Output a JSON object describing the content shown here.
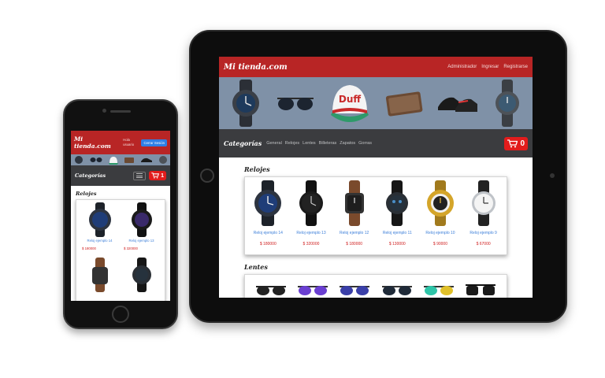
{
  "tablet": {
    "logo": "Mi tienda.com",
    "nav_links": [
      "Administrador",
      "Ingresar",
      "Registrarse"
    ],
    "banner_items": [
      "watch-icon",
      "sunglasses-icon",
      "cap-icon",
      "wallet-icon",
      "shoes-icon",
      "watch-icon"
    ],
    "cap_text": "Duff",
    "categories_label": "Categorías",
    "categories": [
      "General",
      "Relojes",
      "Lentes",
      "Billeteras",
      "Zapatos",
      "Gorras"
    ],
    "cart_count": "0",
    "sections": [
      {
        "title": "Relojes",
        "products": [
          {
            "name": "Reloj ejemplo 14",
            "price": "$ 180000"
          },
          {
            "name": "Reloj ejemplo 13",
            "price": "$ 320000"
          },
          {
            "name": "Reloj ejemplo 12",
            "price": "$ 180000"
          },
          {
            "name": "Reloj ejemplo 11",
            "price": "$ 130000"
          },
          {
            "name": "Reloj ejemplo 10",
            "price": "$ 90000"
          },
          {
            "name": "Reloj ejemplo 9",
            "price": "$ 67000"
          }
        ]
      },
      {
        "title": "Lentes"
      }
    ]
  },
  "phone": {
    "logo": "Mi tienda.com",
    "greeting": "Hola usuario",
    "logout_label": "Cerrar Sesión",
    "categories_label": "Categorías",
    "cart_count": "1",
    "section_title": "Relojes",
    "products": [
      {
        "name": "Reloj ejemplo 14",
        "price": "$ 180000"
      },
      {
        "name": "Reloj ejemplo 13",
        "price": "$ 320000"
      }
    ]
  },
  "colors": {
    "brand_red": "#b82525",
    "banner_blue": "#7f91a7",
    "category_bar": "#3b3c3f",
    "cart_red": "#e21c1c",
    "link_blue": "#3d7fd9",
    "price_red": "#d02020",
    "logout_blue": "#2f7fe6"
  }
}
